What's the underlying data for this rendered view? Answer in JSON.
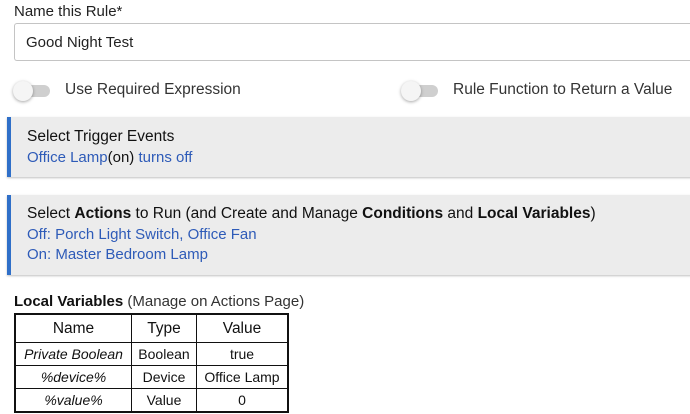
{
  "name_rule": {
    "label": "Name this Rule*",
    "value": "Good Night Test"
  },
  "toggles": [
    {
      "label": "Use Required Expression",
      "on": false
    },
    {
      "label": "Rule Function to Return a Value",
      "on": false
    }
  ],
  "trigger_panel": {
    "title": "Select Trigger Events",
    "device": "Office Lamp",
    "state": "on",
    "action": "turns off"
  },
  "actions_panel": {
    "title_parts": [
      "Select ",
      "Actions",
      " to Run (and Create and Manage ",
      "Conditions",
      " and ",
      "Local Variables",
      ")"
    ],
    "lines": [
      "Off: Porch Light Switch, Office Fan",
      "On: Master Bedroom Lamp"
    ]
  },
  "local_variables": {
    "title": "Local Variables",
    "subtitle": "(Manage on Actions Page)",
    "columns": [
      "Name",
      "Type",
      "Value"
    ],
    "rows": [
      {
        "name": "Private Boolean",
        "type": "Boolean",
        "value": "true"
      },
      {
        "name": "%device%",
        "type": "Device",
        "value": "Office Lamp"
      },
      {
        "name": "%value%",
        "type": "Value",
        "value": "0"
      }
    ]
  },
  "colors": {
    "accent": "#2f6fc8",
    "link": "#2e5bb8",
    "panel_bg": "#ececec"
  }
}
